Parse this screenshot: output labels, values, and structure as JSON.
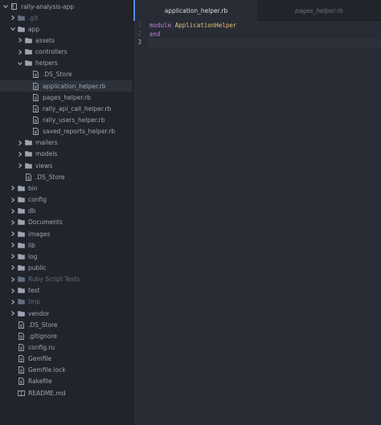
{
  "tree": [
    {
      "label": "rally-analysis-app",
      "kind": "repo",
      "depth": 0,
      "open": true,
      "id": "rally-analysis-app"
    },
    {
      "label": ".git",
      "kind": "folder",
      "depth": 1,
      "open": false,
      "id": "git",
      "dim": true
    },
    {
      "label": "app",
      "kind": "folder",
      "depth": 1,
      "open": true,
      "id": "app"
    },
    {
      "label": "assets",
      "kind": "folder",
      "depth": 2,
      "open": false,
      "id": "assets"
    },
    {
      "label": "controllers",
      "kind": "folder",
      "depth": 2,
      "open": false,
      "id": "controllers"
    },
    {
      "label": "helpers",
      "kind": "folder",
      "depth": 2,
      "open": true,
      "id": "helpers"
    },
    {
      "label": ".DS_Store",
      "kind": "file",
      "depth": 3,
      "id": "helpers-ds-store"
    },
    {
      "label": "application_helper.rb",
      "kind": "file",
      "depth": 3,
      "id": "application-helper",
      "selected": true
    },
    {
      "label": "pages_helper.rb",
      "kind": "file",
      "depth": 3,
      "id": "pages-helper"
    },
    {
      "label": "rally_api_call_helper.rb",
      "kind": "file",
      "depth": 3,
      "id": "rally-api-call-helper"
    },
    {
      "label": "rally_users_helper.rb",
      "kind": "file",
      "depth": 3,
      "id": "rally-users-helper"
    },
    {
      "label": "saved_reports_helper.rb",
      "kind": "file",
      "depth": 3,
      "id": "saved-reports-helper"
    },
    {
      "label": "mailers",
      "kind": "folder",
      "depth": 2,
      "open": false,
      "id": "mailers"
    },
    {
      "label": "models",
      "kind": "folder",
      "depth": 2,
      "open": false,
      "id": "models"
    },
    {
      "label": "views",
      "kind": "folder",
      "depth": 2,
      "open": false,
      "id": "views"
    },
    {
      "label": ".DS_Store",
      "kind": "file",
      "depth": 2,
      "id": "app-ds-store"
    },
    {
      "label": "bin",
      "kind": "folder",
      "depth": 1,
      "open": false,
      "id": "bin"
    },
    {
      "label": "config",
      "kind": "folder",
      "depth": 1,
      "open": false,
      "id": "config"
    },
    {
      "label": "db",
      "kind": "folder",
      "depth": 1,
      "open": false,
      "id": "db"
    },
    {
      "label": "Documents",
      "kind": "folder",
      "depth": 1,
      "open": false,
      "id": "documents"
    },
    {
      "label": "images",
      "kind": "folder",
      "depth": 1,
      "open": false,
      "id": "images"
    },
    {
      "label": "lib",
      "kind": "folder",
      "depth": 1,
      "open": false,
      "id": "lib"
    },
    {
      "label": "log",
      "kind": "folder",
      "depth": 1,
      "open": false,
      "id": "log"
    },
    {
      "label": "public",
      "kind": "folder",
      "depth": 1,
      "open": false,
      "id": "public"
    },
    {
      "label": "Ruby Script Tests",
      "kind": "folder",
      "depth": 1,
      "open": false,
      "id": "ruby-script-tests",
      "dim": true
    },
    {
      "label": "test",
      "kind": "folder",
      "depth": 1,
      "open": false,
      "id": "test"
    },
    {
      "label": "tmp",
      "kind": "folder",
      "depth": 1,
      "open": false,
      "id": "tmp",
      "dim": true
    },
    {
      "label": "vendor",
      "kind": "folder",
      "depth": 1,
      "open": false,
      "id": "vendor"
    },
    {
      "label": ".DS_Store",
      "kind": "file",
      "depth": 1,
      "id": "root-ds-store"
    },
    {
      "label": ".gitignore",
      "kind": "file",
      "depth": 1,
      "id": "gitignore"
    },
    {
      "label": "config.ru",
      "kind": "file",
      "depth": 1,
      "id": "config-ru"
    },
    {
      "label": "Gemfile",
      "kind": "file",
      "depth": 1,
      "id": "gemfile"
    },
    {
      "label": "Gemfile.lock",
      "kind": "file",
      "depth": 1,
      "id": "gemfile-lock"
    },
    {
      "label": "Rakefile",
      "kind": "file",
      "depth": 1,
      "id": "rakefile"
    },
    {
      "label": "README.md",
      "kind": "readme",
      "depth": 1,
      "id": "readme"
    }
  ],
  "tabs": {
    "active": "application_helper.rb",
    "inactive": "pages_helper.rb"
  },
  "editor": {
    "line_numbers": [
      "1",
      "2",
      "3"
    ],
    "cursor_line": 3,
    "lines": [
      {
        "kw": "module",
        "cls": "ApplicationHelper"
      },
      {
        "kw": "end",
        "cls": ""
      },
      {
        "kw": "",
        "cls": ""
      }
    ]
  },
  "colors": {
    "sidebar_bg": "#21252b",
    "editor_bg": "#282c34",
    "selected_row": "#2c313a",
    "active_tab_accent": "#528bff",
    "keyword": "#c678dd",
    "class_name": "#e5c07b"
  },
  "icons": {
    "repo": "repo-icon",
    "folder": "folder-icon",
    "file": "file-text-icon",
    "readme": "book-icon"
  }
}
